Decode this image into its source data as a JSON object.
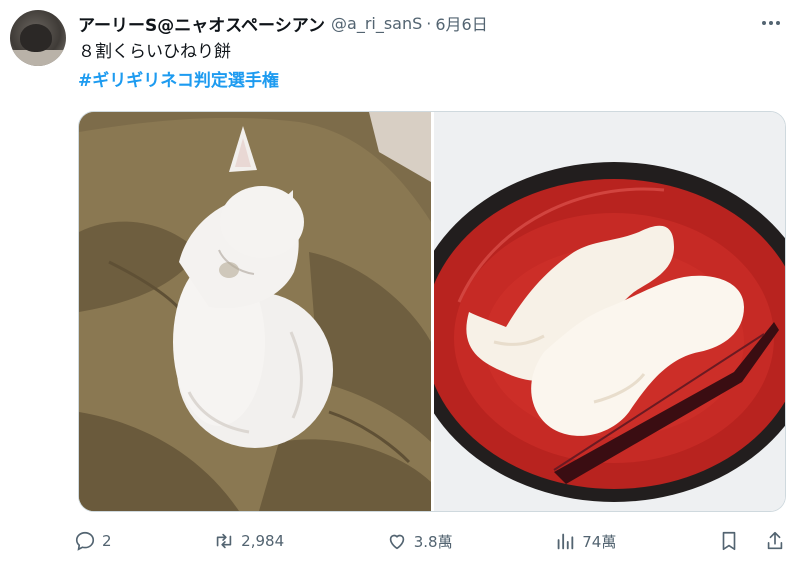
{
  "author": {
    "name": "アーリーS@ニャオスペーシアン",
    "handle": "@a_ri_sanS",
    "separator": "·",
    "date": "6月6日"
  },
  "tweet": {
    "text": "８割くらいひねり餅",
    "hashtag": "#ギリギリネコ判定選手権"
  },
  "media": {
    "left_image": "cat-photo",
    "right_image": "mochi-photo"
  },
  "actions": {
    "reply_count": "2",
    "retweet_count": "2,984",
    "like_count": "3.8萬",
    "views_count": "74萬"
  },
  "colors": {
    "accent": "#1d9bf0",
    "muted": "#536471",
    "text": "#0f1419"
  }
}
